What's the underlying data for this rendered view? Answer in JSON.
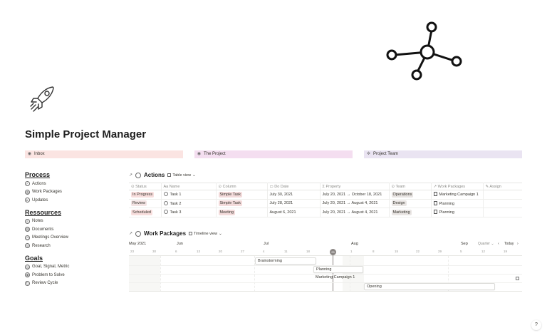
{
  "page": {
    "title": "Simple Project Manager"
  },
  "icons": {
    "cover": "network-nodes-icon",
    "page": "rocket-icon"
  },
  "links": [
    {
      "label": "Inbox",
      "icon": "inbox-icon",
      "color": "#fbe4e2"
    },
    {
      "label": "The Project",
      "icon": "project-icon",
      "color": "#f4def0"
    },
    {
      "label": "Project Team",
      "icon": "team-icon",
      "color": "#eae4f2"
    }
  ],
  "sidebar": {
    "sections": [
      {
        "title": "Process",
        "items": [
          "Actions",
          "Work Packages",
          "Updates"
        ]
      },
      {
        "title": "Ressources",
        "items": [
          "Notes",
          "Documents",
          "Meetings Overview",
          "Research"
        ]
      },
      {
        "title": "Goals",
        "items": [
          "Goal, Signal, Metric",
          "Problem to Solve",
          "Review Cycle"
        ]
      }
    ]
  },
  "actions_db": {
    "title": "Actions",
    "view": "Table view",
    "columns": [
      "Status",
      "Name",
      "Column",
      "Do Date",
      "Property",
      "Team",
      "Work Packages",
      "Assign"
    ],
    "rows": [
      {
        "status": "In Progress",
        "name": "Task 1",
        "column": "Simple Task",
        "do_date": "July 30, 2021",
        "property": "July 20, 2021 → October 18, 2021",
        "team": "Operations",
        "work_package": "Marketing Campaign 1",
        "assign": ""
      },
      {
        "status": "Review",
        "name": "Task 2",
        "column": "Simple Task",
        "do_date": "July 28, 2021",
        "property": "July 20, 2021 → August 4, 2021",
        "team": "Design",
        "work_package": "Planning",
        "assign": ""
      },
      {
        "status": "Scheduled",
        "name": "Task 3",
        "column": "Meeting",
        "do_date": "August 6, 2021",
        "property": "July 20, 2021 → August 4, 2021",
        "team": "Marketing",
        "work_package": "Planning",
        "assign": ""
      }
    ]
  },
  "work_packages_db": {
    "title": "Work Packages",
    "view": "Timeline view",
    "months": [
      "May 2021",
      "Jun",
      "Jul",
      "Aug",
      "Sep"
    ],
    "days": [
      "23",
      "30",
      "6",
      "13",
      "20",
      "27",
      "4",
      "11",
      "18",
      "25",
      "1",
      "8",
      "15",
      "22",
      "29",
      "5",
      "12",
      "19"
    ],
    "today": "25",
    "controls": {
      "range": "Quarter",
      "today": "Today"
    },
    "bars": [
      "Brainstorming",
      "Planning",
      "Marketing Campaign 1",
      "Opening"
    ]
  },
  "help": "?"
}
